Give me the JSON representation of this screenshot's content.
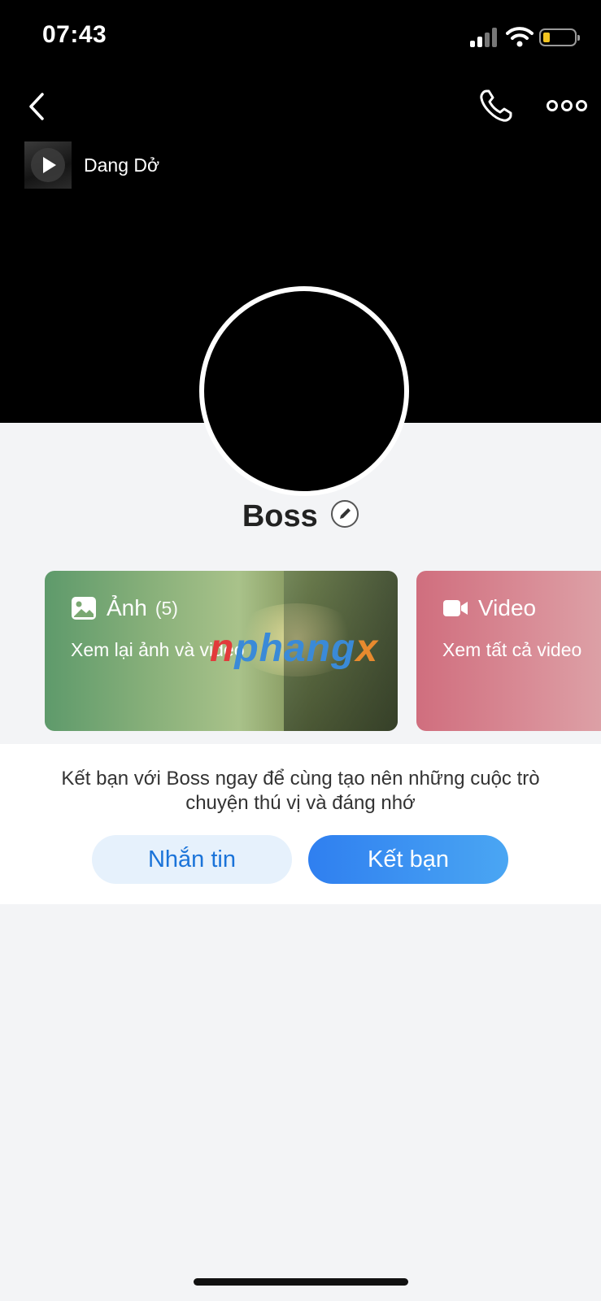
{
  "status_bar": {
    "time": "07:43"
  },
  "music": {
    "title": "Dang Dở"
  },
  "profile": {
    "name": "Boss"
  },
  "cards": {
    "photos": {
      "title": "Ảnh",
      "count": "(5)",
      "subtitle": "Xem lại ảnh và video"
    },
    "videos": {
      "title": "Video",
      "subtitle": "Xem tất cả video"
    }
  },
  "watermark": {
    "part1": "n",
    "part2": "phang",
    "part3": "x"
  },
  "friend_panel": {
    "message": "Kết bạn với Boss ngay để cùng tạo nên những cuộc trò chuyện thú vị và đáng nhớ",
    "message_button": "Nhắn tin",
    "add_friend_button": "Kết bạn"
  },
  "colors": {
    "accent": "#2f7ff0",
    "photo_card": "#88b07a",
    "video_card": "#d06e7e"
  }
}
